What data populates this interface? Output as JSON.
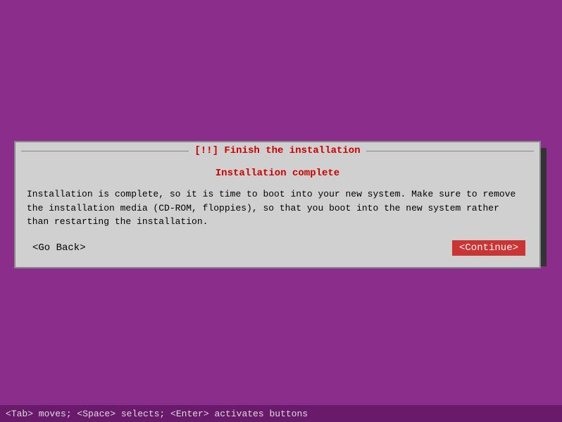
{
  "background_color": "#8B2D8B",
  "dialog": {
    "title": "[!!] Finish the installation",
    "subtitle": "Installation complete",
    "message": "Installation is complete, so it is time to boot into your new system. Make sure to remove\nthe installation media (CD-ROM, floppies), so that you boot into the new system rather\nthan restarting the installation.",
    "go_back_label": "<Go Back>",
    "continue_label": "<Continue>"
  },
  "status_bar": {
    "text": "<Tab> moves; <Space> selects; <Enter> activates buttons"
  }
}
